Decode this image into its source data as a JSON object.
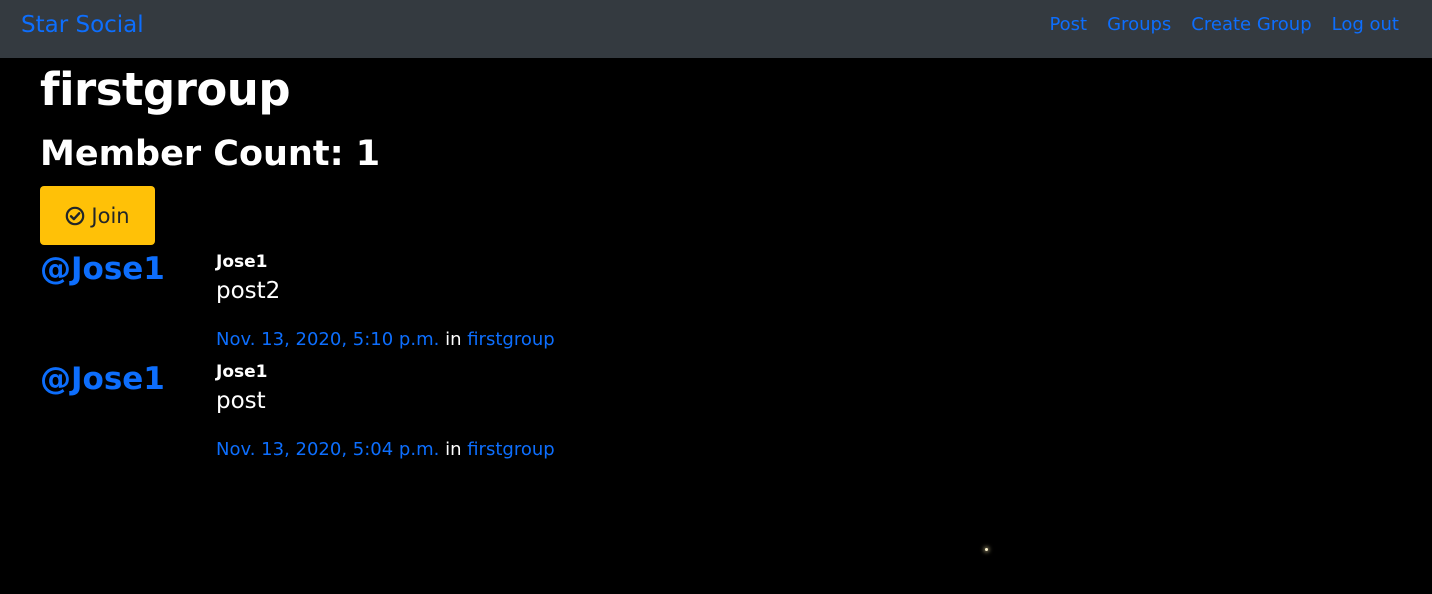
{
  "navbar": {
    "brand": "Star Social",
    "links": [
      {
        "label": "Post"
      },
      {
        "label": "Groups"
      },
      {
        "label": "Create Group"
      },
      {
        "label": "Log out"
      }
    ]
  },
  "group": {
    "name": "firstgroup",
    "member_count_label": "Member Count: 1",
    "join_label": "Join",
    "join_icon": "check-circle-icon"
  },
  "posts": [
    {
      "handle": "@Jose1",
      "username": "Jose1",
      "text": "post2",
      "timestamp": "Nov. 13, 2020, 5:10 p.m.",
      "in_word": "in",
      "group": "firstgroup"
    },
    {
      "handle": "@Jose1",
      "username": "Jose1",
      "text": "post",
      "timestamp": "Nov. 13, 2020, 5:04 p.m.",
      "in_word": "in",
      "group": "firstgroup"
    }
  ],
  "colors": {
    "background": "#000000",
    "navbar": "#343a40",
    "link": "#0d6efd",
    "warning": "#ffc107"
  }
}
